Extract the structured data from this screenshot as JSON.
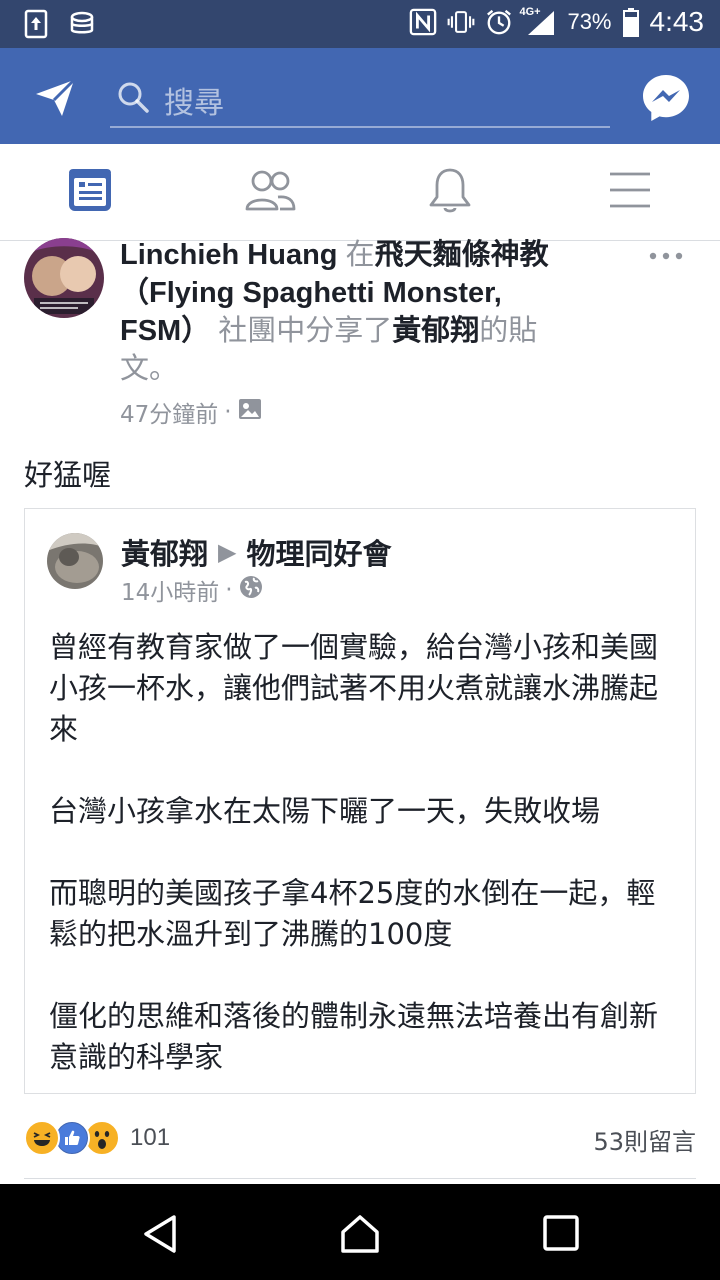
{
  "status_bar": {
    "battery_percent": "73%",
    "time": "4:43",
    "network": "4G+",
    "icons": [
      "upload-icon",
      "database-icon",
      "nfc-icon",
      "vibrate-icon",
      "alarm-icon",
      "signal-icon",
      "battery-icon"
    ]
  },
  "app_bar": {
    "search_placeholder": "搜尋",
    "icons": [
      "send-icon",
      "search-icon",
      "messenger-icon"
    ]
  },
  "tabs": [
    {
      "name": "news-feed",
      "icon": "news-feed-icon",
      "active": true
    },
    {
      "name": "friends",
      "icon": "friends-icon",
      "active": false
    },
    {
      "name": "notifications",
      "icon": "bell-icon",
      "active": false
    },
    {
      "name": "menu",
      "icon": "hamburger-icon",
      "active": false
    }
  ],
  "post": {
    "author": "Linchieh Huang",
    "in_word": " 在",
    "group": "飛天麵條神教（Flying Spaghetti Monster, FSM）",
    "shared_text": " 社團中分享了",
    "original_author": "黃郁翔",
    "suffix": "的貼文。",
    "time": "47分鐘前",
    "audience_icon": "group-photo-icon",
    "text": "好猛喔",
    "shared": {
      "author": "黃郁翔",
      "arrow": "▶",
      "group": "物理同好會",
      "time": "14小時前",
      "audience_icon": "globe-icon",
      "paragraphs": [
        "曾經有教育家做了一個實驗，給台灣小孩和美國小孩一杯水，讓他們試著不用火煮就讓水沸騰起來",
        "台灣小孩拿水在太陽下曬了一天，失敗收場",
        "而聰明的美國孩子拿4杯25度的水倒在一起，輕鬆的把水溫升到了沸騰的100度",
        "僵化的思維和落後的體制永遠無法培養出有創新意識的科學家"
      ]
    },
    "reactions": {
      "types": [
        "haha",
        "like",
        "wow"
      ],
      "count": "101"
    },
    "comments": "53則留言"
  },
  "colors": {
    "status_bar": "#33466e",
    "app_bar": "#4267b2",
    "accent": "#4267b2",
    "text": "#1d2129",
    "muted": "#90949c"
  }
}
